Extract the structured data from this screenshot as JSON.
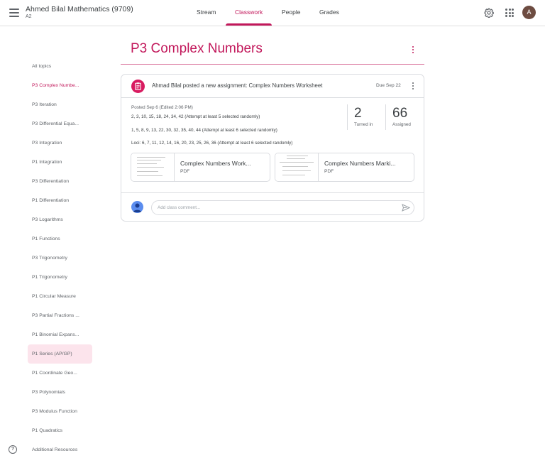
{
  "header": {
    "class_name": "Ahmed Bilal Mathematics (9709)",
    "class_section": "A2",
    "tabs": [
      "Stream",
      "Classwork",
      "People",
      "Grades"
    ],
    "active_tab": "Classwork",
    "avatar_letter": "A",
    "accent_color": "#c2185b"
  },
  "sidebar": {
    "items": [
      "All topics",
      "P3 Complex Numbe...",
      "P3 Iteration",
      "P3 Differential Equa...",
      "P3 Integration",
      "P1 Integration",
      "P3 Differentiation",
      "P1 Differentiation",
      "P3 Logarithms",
      "P1 Functions",
      "P3 Trigonometry",
      "P1 Trigonometry",
      "P1 Circular Measure",
      "P3 Partial Fractions ...",
      "P1 Binomial Expans...",
      "P1 Series (AP/GP)",
      "P1 Coordinate Geo...",
      "P3 Polynomials",
      "P3 Modulus Function",
      "P1 Quadratics",
      "Additional Resources"
    ],
    "active_item": "P3 Complex Numbe...",
    "highlighted_item": "P1 Series (AP/GP)"
  },
  "topic": {
    "title": "P3 Complex Numbers"
  },
  "assignment": {
    "title": "Ahmad Bilal posted a new assignment: Complex Numbers Worksheet",
    "due": "Due Sep 22",
    "posted": "Posted Sep 6 (Edited 2:06 PM)",
    "instructions": [
      "2, 3, 10, 15, 18, 24, 34, 42 (Attempt at least 5 selected randomly)",
      "1, 5, 8, 9, 13, 22, 30, 32, 35, 40, 44 (Attempt at least 6 selected randomly)",
      "Loci: 6, 7, 11, 12, 14, 16, 20, 23, 25, 26, 36 (Attempt at least 6 selected randomly)"
    ],
    "turned_in": "2",
    "turned_in_label": "Turned in",
    "assigned": "66",
    "assigned_label": "Assigned",
    "attachments": [
      {
        "title": "Complex Numbers Work...",
        "type": "PDF"
      },
      {
        "title": "Complex Numbers Marki...",
        "type": "PDF"
      }
    ],
    "comment_placeholder": "Add class comment..."
  }
}
